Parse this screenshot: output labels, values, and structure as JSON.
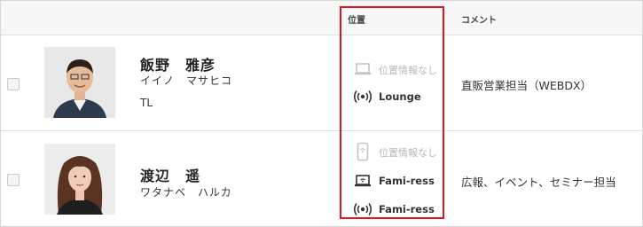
{
  "header": {
    "location_label": "位置",
    "comment_label": "コメント"
  },
  "members": [
    {
      "name": "飯野　雅彦",
      "kana": "イイノ　マサヒコ",
      "role": "TL",
      "locations": [
        {
          "icon": "laptop-icon",
          "text": "位置情報なし",
          "state": "none"
        },
        {
          "icon": "beacon-icon",
          "text": "Lounge",
          "state": "active"
        }
      ],
      "comment": "直販営業担当（WEBDX）"
    },
    {
      "name": "渡辺　遥",
      "kana": "ワタナベ　ハルカ",
      "role": "",
      "locations": [
        {
          "icon": "phone-icon",
          "text": "位置情報なし",
          "state": "none"
        },
        {
          "icon": "laptop-icon",
          "text": "Fami-ress",
          "state": "active"
        },
        {
          "icon": "beacon-icon",
          "text": "Fami-ress",
          "state": "active"
        }
      ],
      "comment": "広報、イベント、セミナー担当"
    }
  ],
  "colors": {
    "highlight": "#e0151f",
    "muted": "#b8b8b8",
    "text": "#333333"
  }
}
